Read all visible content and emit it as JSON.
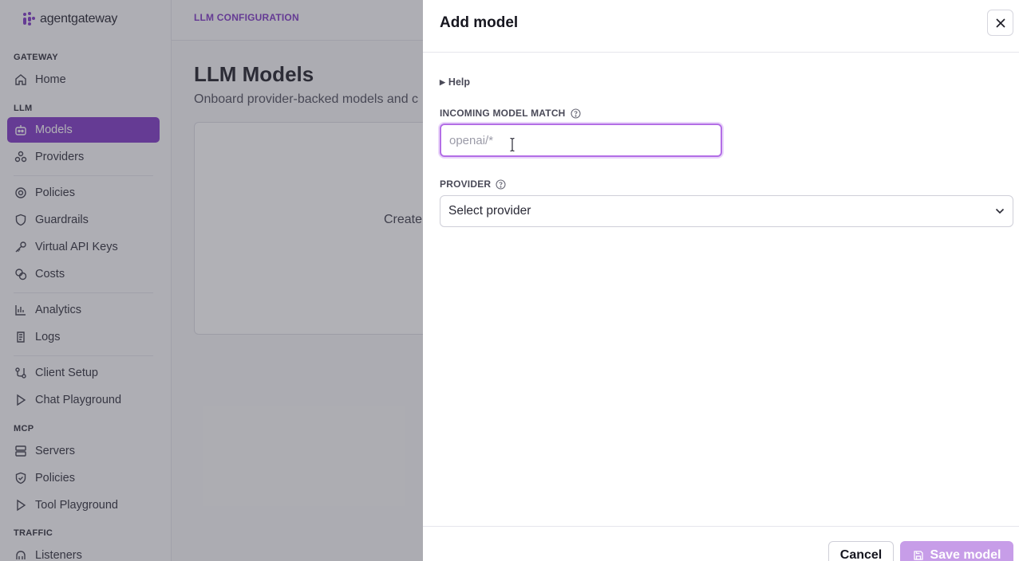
{
  "brand": {
    "name": "agentgateway",
    "accent": "#7d35c4"
  },
  "sidebar": {
    "sections": {
      "gateway": "GATEWAY",
      "llm": "LLM",
      "mcp": "MCP",
      "traffic": "TRAFFIC"
    },
    "items": {
      "home": {
        "label": "Home",
        "icon": "home-icon"
      },
      "models": {
        "label": "Models",
        "icon": "models-icon",
        "active": true
      },
      "providers": {
        "label": "Providers",
        "icon": "providers-icon"
      },
      "policies": {
        "label": "Policies",
        "icon": "policies-icon"
      },
      "guardrails": {
        "label": "Guardrails",
        "icon": "shield-icon"
      },
      "virtual_api_keys": {
        "label": "Virtual API Keys",
        "icon": "key-icon"
      },
      "costs": {
        "label": "Costs",
        "icon": "coins-icon"
      },
      "analytics": {
        "label": "Analytics",
        "icon": "chart-icon"
      },
      "logs": {
        "label": "Logs",
        "icon": "logs-icon"
      },
      "client_setup": {
        "label": "Client Setup",
        "icon": "client-setup-icon"
      },
      "chat_playground": {
        "label": "Chat Playground",
        "icon": "play-icon"
      },
      "servers": {
        "label": "Servers",
        "icon": "server-icon"
      },
      "mcp_policies": {
        "label": "Policies",
        "icon": "shield-check-icon"
      },
      "tool_playground": {
        "label": "Tool Playground",
        "icon": "play-icon"
      },
      "listeners": {
        "label": "Listeners",
        "icon": "listeners-icon"
      }
    }
  },
  "topbar": {
    "breadcrumb": "LLM CONFIGURATION"
  },
  "main": {
    "title": "LLM Models",
    "subtitle": "Onboard provider-backed models and c",
    "empty_text": "Create"
  },
  "drawer": {
    "title": "Add model",
    "help_label": "Help",
    "incoming_model_match": {
      "label": "INCOMING MODEL MATCH",
      "placeholder": "openai/*",
      "value": ""
    },
    "provider": {
      "label": "PROVIDER",
      "selected": "Select provider"
    },
    "cancel_label": "Cancel",
    "save_label": "Save model"
  }
}
